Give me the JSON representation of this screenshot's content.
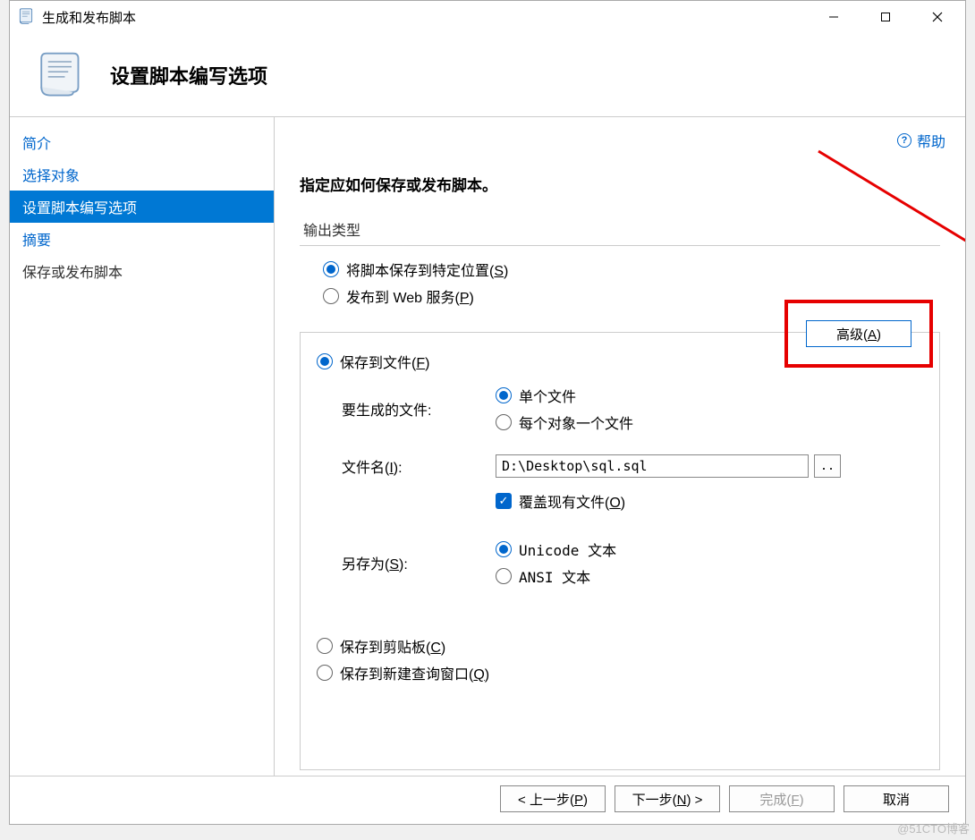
{
  "window": {
    "title": "生成和发布脚本"
  },
  "header": {
    "title": "设置脚本编写选项"
  },
  "sidebar": {
    "items": [
      {
        "label": "简介",
        "active": false
      },
      {
        "label": "选择对象",
        "active": false
      },
      {
        "label": "设置脚本编写选项",
        "active": true
      },
      {
        "label": "摘要",
        "active": false
      },
      {
        "label": "保存或发布脚本",
        "active": false
      }
    ]
  },
  "help": {
    "label": "帮助"
  },
  "content": {
    "instruction": "指定应如何保存或发布脚本。",
    "output_type_label": "输出类型",
    "save_location": "将脚本保存到特定位置(",
    "save_location_key": "S",
    "publish_web": "发布到 Web 服务(",
    "publish_web_key": "P",
    "save_file": "保存到文件(",
    "save_file_key": "F",
    "gen_files_label": "要生成的文件:",
    "single_file": "单个文件",
    "per_object": "每个对象一个文件",
    "filename_label": "文件名(",
    "filename_key": "I",
    "filename_value": "D:\\Desktop\\sql.sql",
    "overwrite": "覆盖现有文件(",
    "overwrite_key": "O",
    "saveas_label": "另存为(",
    "saveas_key": "S",
    "unicode": "Unicode 文本",
    "ansi": "ANSI 文本",
    "clipboard": "保存到剪贴板(",
    "clipboard_key": "C",
    "newquery": "保存到新建查询窗口(",
    "newquery_key": "Q",
    "advanced": "高级(",
    "advanced_key": "A",
    "browse": "..",
    "close_paren": ")",
    "colon_close": "):"
  },
  "footer": {
    "prev": "< 上一步(",
    "prev_key": "P",
    "next": "下一步(",
    "next_key": "N",
    "next_suffix": ") >",
    "finish": "完成(",
    "finish_key": "F",
    "cancel": "取消"
  },
  "watermark": "@51CTO博客"
}
